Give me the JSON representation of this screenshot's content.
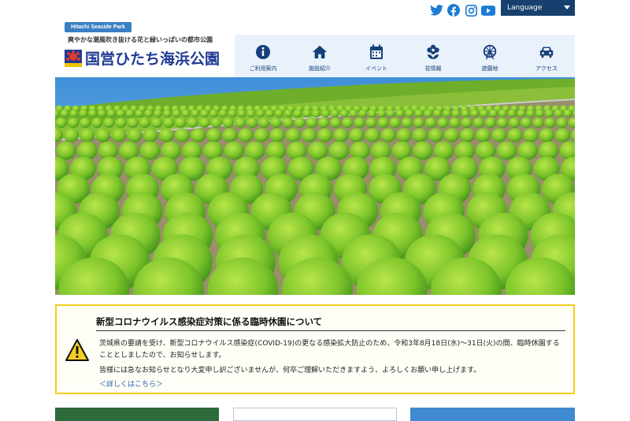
{
  "header": {
    "badge": "Hitachi Seaside Park",
    "tagline": "爽やかな潮風吹き抜ける花と緑いっぱいの都市公園",
    "park_name": "国営ひたち海浜公園",
    "language_label": "Language",
    "social_icons": [
      "twitter-icon",
      "facebook-icon",
      "instagram-icon",
      "youtube-icon"
    ]
  },
  "nav": {
    "items": [
      {
        "label": "ご利用案内",
        "icon": "info-icon"
      },
      {
        "label": "施設紹介",
        "icon": "home-icon"
      },
      {
        "label": "イベント",
        "icon": "calendar-icon"
      },
      {
        "label": "花情報",
        "icon": "flower-icon"
      },
      {
        "label": "遊園地",
        "icon": "ferris-wheel-icon"
      },
      {
        "label": "アクセス",
        "icon": "car-icon"
      }
    ]
  },
  "notice": {
    "title": "新型コロナウイルス感染症対策に係る臨時休園について",
    "paragraph1": "茨城県の要請を受け、新型コロナウイルス感染症(COVID-19)の更なる感染拡大防止のため、令和3年8月18日(水)～31日(火)の間、臨時休園することとしましたので、お知らせします。",
    "paragraph2": "皆様には急なお知らせとなり大変申し訳ございませんが、何卒ご理解いただきますよう、よろしくお願い申し上げます。",
    "link": "＜詳しくはこちら＞"
  },
  "colors": {
    "nav_bg": "#e9f1fa",
    "nav_text": "#16407a",
    "lang_bg": "#17406e",
    "notice_border": "#f2cd1f",
    "social_blue": "#1d7bd6"
  }
}
